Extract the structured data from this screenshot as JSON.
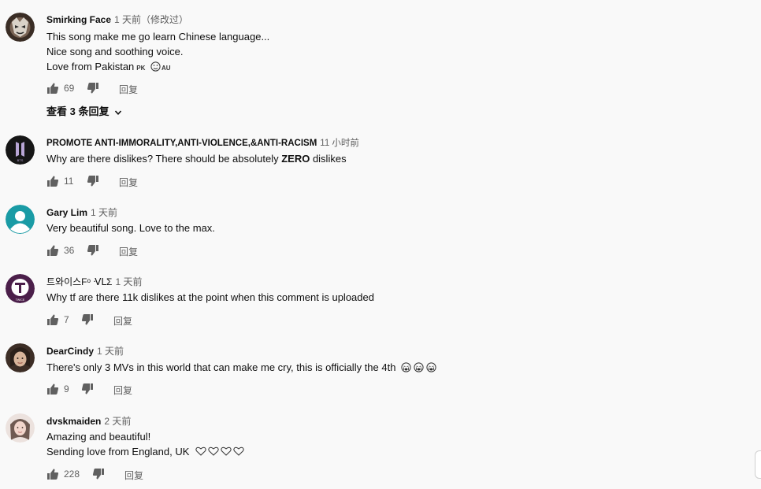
{
  "comments": [
    {
      "author": "Smirking Face",
      "time": "1 天前（修改过）",
      "lines": [
        "This song make me go learn Chinese language...",
        "Nice song and soothing voice.",
        "Love from Pakistan"
      ],
      "flag_pk": "PK",
      "flag_au": "AU",
      "likes": "69",
      "reply_label": "回复",
      "view_replies": "查看 3 条回复",
      "avatar_color": "#5a4636"
    },
    {
      "author": "PROMOTE ANTI-IMMORALITY,ANTI-VIOLENCE,&ANTI-RACISM",
      "time": "11 小时前",
      "line_pre": "Why are there dislikes? There should be absolutely ",
      "line_bold": "ZERO",
      "line_post": " dislikes",
      "likes": "11",
      "reply_label": "回复",
      "avatar_text": "BTS",
      "avatar_color": "#161616"
    },
    {
      "author": "Gary Lim",
      "time": "1 天前",
      "lines": [
        "Very beautiful song. Love to the max."
      ],
      "likes": "36",
      "reply_label": "回复",
      "avatar_color": "#1a9ba5"
    },
    {
      "author": "트와이스Fᵒ ᐺᒪΣ",
      "time": "1 天前",
      "lines": [
        "Why tf are there 11k dislikes at the point when this comment is uploaded"
      ],
      "likes": "7",
      "reply_label": "回复",
      "avatar_text": "TWICE",
      "avatar_color": "#4b1f4a"
    },
    {
      "author": "DearCindy",
      "time": "1 天前",
      "lines": [
        "There's only 3 MVs in this world that can make me cry, this is officially the 4th"
      ],
      "likes": "9",
      "reply_label": "回复",
      "avatar_color": "#6d5443"
    },
    {
      "author": "dvskmaiden",
      "time": "2 天前",
      "lines": [
        "Amazing and beautiful!",
        "Sending love from England, UK"
      ],
      "likes": "228",
      "reply_label": "回复",
      "avatar_color": "#d9c8c4"
    }
  ],
  "icons": {
    "like": "thumb-up-icon",
    "dislike": "thumb-down-icon",
    "chevron": "chevron-down-icon",
    "crying": "crying-emoji-icon",
    "heart": "heart-outline-icon"
  },
  "colors": {
    "background": "#f9f9f9",
    "text": "#0f0f0f",
    "secondary": "#606060",
    "icon": "#606060"
  }
}
